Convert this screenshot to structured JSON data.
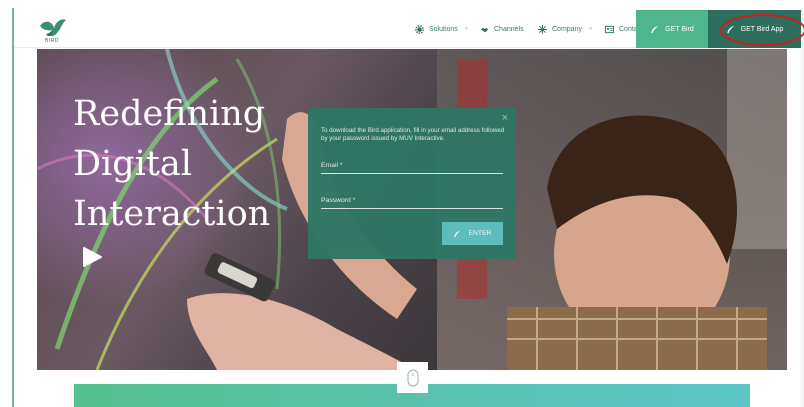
{
  "header": {
    "logo_text": "BIRD",
    "nav": [
      {
        "label": "Solutions",
        "icon": "gear-icon",
        "has_dropdown": true
      },
      {
        "label": "Channels",
        "icon": "handshake-icon",
        "has_dropdown": false
      },
      {
        "label": "Company",
        "icon": "sparkle-icon",
        "has_dropdown": true
      },
      {
        "label": "Contact",
        "icon": "contact-card-icon",
        "has_dropdown": false
      }
    ],
    "get_bird": "GET Bird",
    "get_bird_app": "GET Bird App",
    "dropdown_glyph": "»"
  },
  "hero": {
    "headline": [
      "Redefining",
      "Digital",
      "Interaction"
    ]
  },
  "modal": {
    "close": "×",
    "message": "To download the Bird application, fill in your email address followed by your password issued by MUV Interactive.",
    "email_label": "Email *",
    "password_label": "Password *",
    "enter_label": "ENTER"
  },
  "colors": {
    "brand_green": "#4eb58c",
    "brand_dark": "#2e6e5e",
    "modal_bg": "#2f7665",
    "enter_bg": "#5cc1bf",
    "highlight_ring": "#d21c1c"
  }
}
